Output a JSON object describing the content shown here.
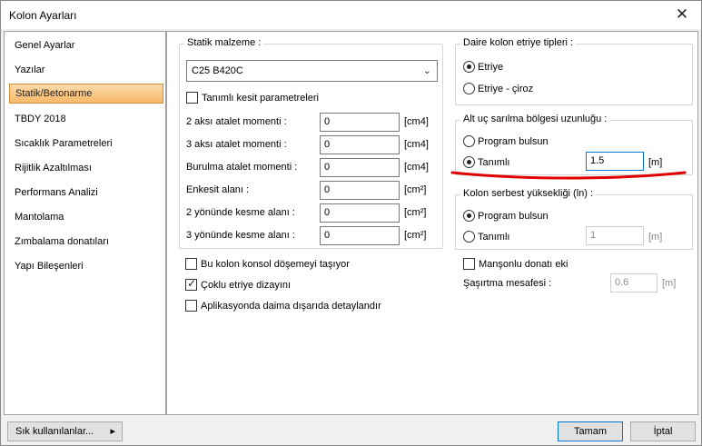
{
  "window": {
    "title": "Kolon Ayarları",
    "close_glyph": "✕"
  },
  "sidebar": {
    "items": [
      {
        "label": "Genel Ayarlar"
      },
      {
        "label": "Yazılar"
      },
      {
        "label": "Statik/Betonarme"
      },
      {
        "label": "TBDY 2018"
      },
      {
        "label": "Sıcaklık Parametreleri"
      },
      {
        "label": "Rijitlik Azaltılması"
      },
      {
        "label": "Performans Analizi"
      },
      {
        "label": "Mantolama"
      },
      {
        "label": "Zımbalama donatıları"
      },
      {
        "label": "Yapı Bileşenleri"
      }
    ],
    "selected_index": 2
  },
  "static_material": {
    "title": "Statik malzeme :",
    "material_value": "C25 B420C",
    "custom_section_label": "Tanımlı kesit parametreleri",
    "custom_section_checked": false,
    "rows": [
      {
        "label": "2 aksı atalet momenti :",
        "value": "0",
        "unit": "[cm4]"
      },
      {
        "label": "3 aksı atalet momenti :",
        "value": "0",
        "unit": "[cm4]"
      },
      {
        "label": "Burulma atalet momenti :",
        "value": "0",
        "unit": "[cm4]"
      },
      {
        "label": "Enkesit alanı :",
        "value": "0",
        "unit": "[cm²]"
      },
      {
        "label": "2 yönünde kesme alanı :",
        "value": "0",
        "unit": "[cm²]"
      },
      {
        "label": "3 yönünde kesme alanı :",
        "value": "0",
        "unit": "[cm²]"
      }
    ]
  },
  "stirrup_types": {
    "title": "Daire kolon etriye tipleri :",
    "options": [
      {
        "label": "Etriye",
        "selected": true
      },
      {
        "label": "Etriye - çiroz",
        "selected": false
      }
    ]
  },
  "bottom_confinement": {
    "title": "Alt uç sarılma bölgesi uzunluğu :",
    "option_auto": "Program bulsun",
    "option_defined": "Tanımlı",
    "selected": "defined",
    "value": "1.5",
    "unit": "[m]"
  },
  "free_height": {
    "title": "Kolon serbest yüksekliği (ln) :",
    "option_auto": "Program bulsun",
    "option_defined": "Tanımlı",
    "selected": "auto",
    "value": "1",
    "unit": "[m]"
  },
  "checks_left": [
    {
      "label": "Bu kolon konsol döşemeyi taşıyor",
      "checked": false
    },
    {
      "label": "Çoklu etriye dizayını",
      "checked": true
    },
    {
      "label": "Aplikasyonda daima dışarıda detaylandır",
      "checked": false
    }
  ],
  "sleeve": {
    "label": "Manşonlu donatı eki",
    "checked": false,
    "offset_label": "Şaşırtma mesafesi :",
    "offset_value": "0.6",
    "offset_unit": "[m]"
  },
  "footer": {
    "favorites_label": "Sık kullanılanlar...",
    "favorites_arrow": "▸",
    "ok_label": "Tamam",
    "cancel_label": "İptal"
  },
  "colors": {
    "accent_red": "#e00000",
    "selection_orange": "#f7b96a",
    "focus_blue": "#0078d7"
  }
}
